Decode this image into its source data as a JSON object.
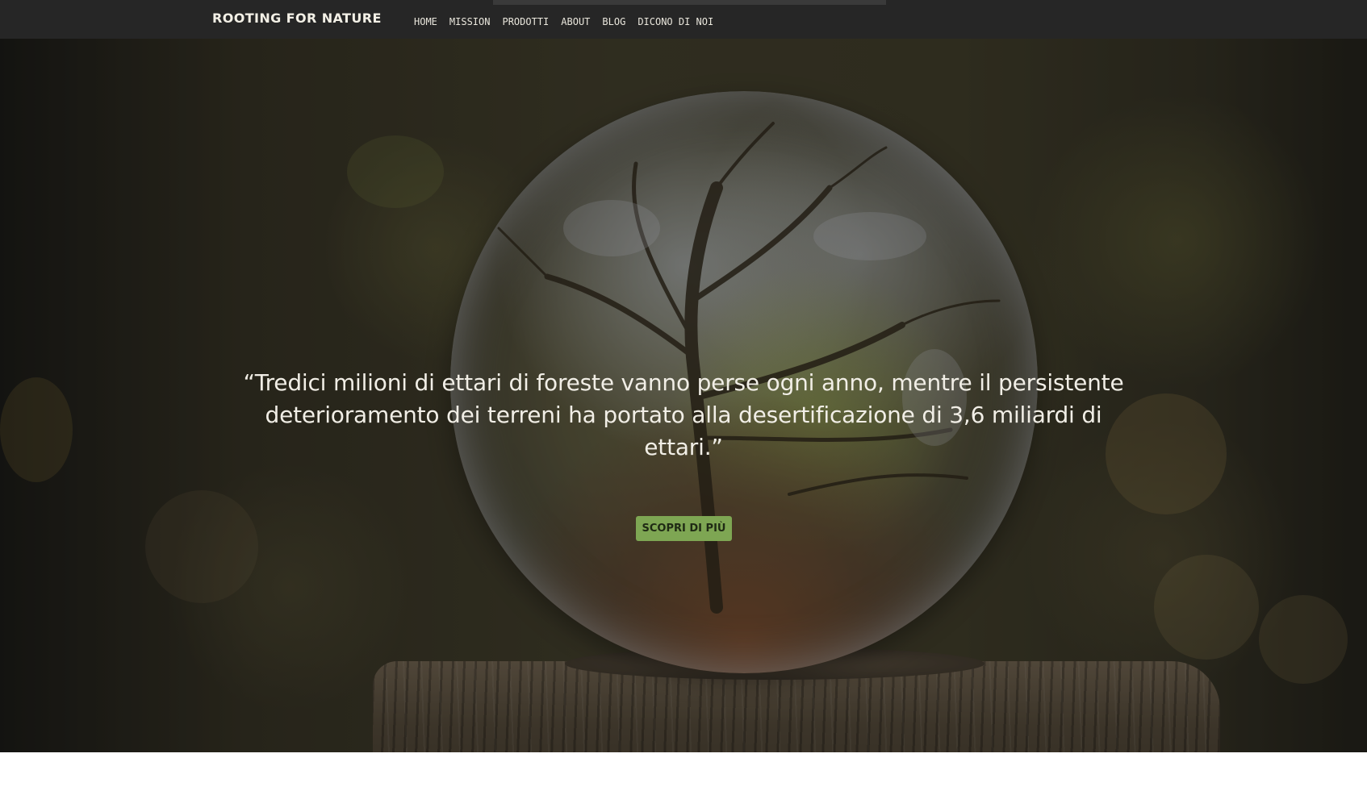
{
  "navbar": {
    "brand": "ROOTING FOR NATURE",
    "links": [
      {
        "label": "HOME"
      },
      {
        "label": "MISSION"
      },
      {
        "label": "PRODOTTI"
      },
      {
        "label": "ABOUT"
      },
      {
        "label": "BLOG"
      },
      {
        "label": "DICONO DI NOI"
      }
    ]
  },
  "hero": {
    "quote": "“Tredici milioni di ettari di foreste vanno perse ogni anno, mentre il persistente deterioramento dei terreni ha portato alla desertificazione di 3,6 miliardi di ettari.”",
    "cta_label": "SCOPRI DI PIÙ",
    "background_image": "crystal-ball-forest-on-tree-stump"
  },
  "colors": {
    "navbar_bg": "#262626",
    "brand_text": "#f3f0e6",
    "cta_bg": "#7ea653",
    "cta_text": "#1f2a14"
  }
}
